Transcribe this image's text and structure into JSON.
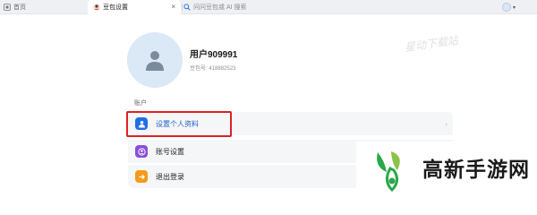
{
  "tabs": {
    "home_label": "首页",
    "settings_label": "豆包设置",
    "settings_close": "×",
    "search_placeholder": "问问豆包或 AI 搜索"
  },
  "profile": {
    "username": "用户909991",
    "id_text": "豆包号: 418892523"
  },
  "account": {
    "section_label": "账户",
    "rows": [
      {
        "label": "设置个人资料",
        "icon": "person-icon",
        "color": "#1f6fe6"
      },
      {
        "label": "账号设置",
        "icon": "account-icon",
        "color": "#8a4fd8"
      },
      {
        "label": "退出登录",
        "icon": "logout-arrow-icon",
        "color": "#f39a1a"
      }
    ],
    "chevron": "›"
  },
  "watermarks": {
    "top": "星动下载站",
    "bottom": "高新手游网"
  },
  "colors": {
    "highlight": "#e01f26",
    "primary": "#1f6fe6"
  }
}
